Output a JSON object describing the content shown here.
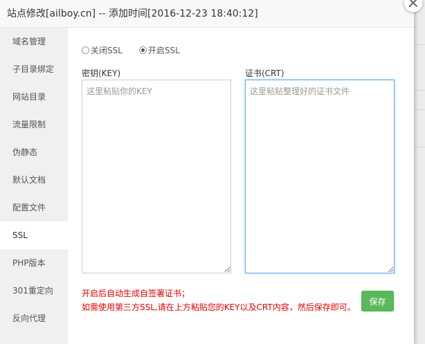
{
  "dialog": {
    "title": "站点修改[ailboy.cn] -- 添加时间[2016-12-23 18:40:12]"
  },
  "sidebar": {
    "items": [
      {
        "label": "域名管理"
      },
      {
        "label": "子目录绑定"
      },
      {
        "label": "网站目录"
      },
      {
        "label": "流量限制"
      },
      {
        "label": "伪静态"
      },
      {
        "label": "默认文档"
      },
      {
        "label": "配置文件"
      },
      {
        "label": "SSL"
      },
      {
        "label": "PHP版本"
      },
      {
        "label": "301重定向"
      },
      {
        "label": "反向代理"
      }
    ],
    "active": "SSL"
  },
  "ssl": {
    "options": [
      {
        "label": "关闭SSL",
        "checked": false
      },
      {
        "label": "开启SSL",
        "checked": true
      }
    ],
    "key": {
      "label": "密钥(KEY)",
      "placeholder": "这里粘贴你的KEY",
      "value": ""
    },
    "crt": {
      "label": "证书(CRT)",
      "placeholder": "这里粘贴整理好的证书文件",
      "value": ""
    },
    "notes": [
      "开启后自动生成自签署证书；",
      "如需使用第三方SSL,请在上方粘贴您的KEY以及CRT内容，然后保存即可。"
    ],
    "save_label": "保存"
  },
  "colors": {
    "accent_focus": "#66afe9",
    "save_button": "#5cb85c",
    "warning_text": "#e60000"
  }
}
